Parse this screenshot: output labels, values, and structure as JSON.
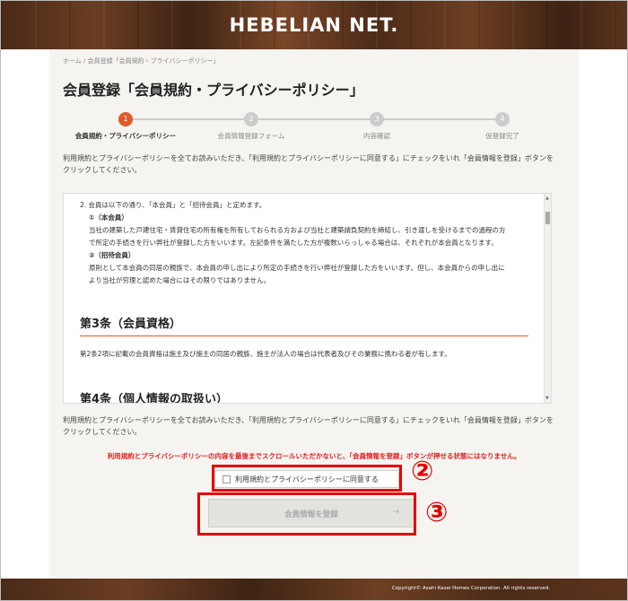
{
  "site": {
    "logo": "HEBELIAN NET."
  },
  "breadcrumb": "ホーム / 会員登録「会員規約・プライバシーポリシー」",
  "page_title": "会員登録「会員規約・プライバシーポリシー」",
  "steps": [
    {
      "num": "1",
      "label": "会員規約・プライバシーポリシー",
      "active": true
    },
    {
      "num": "2",
      "label": "会員情報登録フォーム",
      "active": false
    },
    {
      "num": "3",
      "label": "内容確認",
      "active": false
    },
    {
      "num": "4",
      "label": "仮登録完了",
      "active": false
    }
  ],
  "intro_text_1": "利用規約とプライバシーポリシーを全てお読みいただき、「利用規約とプライバシーポリシーに同意する」にチェックをいれ「会員情報を登録」ボタンを",
  "intro_text_2": "クリックしてください。",
  "terms": {
    "p1": "2. 会員は以下の通り、「本会員」と「招待会員」と定めます。",
    "h_main": "①（本会員）",
    "main_1": "当社の建築した戸建住宅・賃貸住宅の所有権を所有しておられる方および当社と建築請負契約を締結し、引き渡しを受けるまでの過程の方",
    "main_2": "で所定の手続きを行い弊社が登録した方をいいます。左記条件を満たした方が複数いらっしゃる場合は、それぞれが本会員となります。",
    "h_invite": "②（招待会員）",
    "invite_1": "原則として本会員の同居の親族で、本会員の申し出により所定の手続きを行い弊社が登録した方をいいます。但し、本会員からの申し出に",
    "invite_2": "より当社が穷理と認めた場合にはその限りではありません。",
    "art3_title": "第3条（会員資格）",
    "art3_body": "第2条2項に記載の会員資格は施主及び施主の同居の親族、施主が法人の場合は代表者及びその業務に携わる者が有します。",
    "art4_title": "第4条（個人情報の取扱い）"
  },
  "warning": "利用規約とプライバシーポリシーの内容を最後までスクロールいただかないと、「会員情報を登録」ボタンが押せる状態にはなりません。",
  "agree_label": "利用規約とプライバシーポリシーに同意する",
  "submit_label": "会員情報を登録",
  "submit_arrow": "→",
  "callouts": {
    "two": "②",
    "three": "③"
  },
  "footer": {
    "copyright": "Copyright© Asahi Kasei Homes Corporation. All rights reserved."
  },
  "colors": {
    "accent": "#e05a2b",
    "annotation": "#e60000",
    "header_wood": "#5a321c"
  }
}
